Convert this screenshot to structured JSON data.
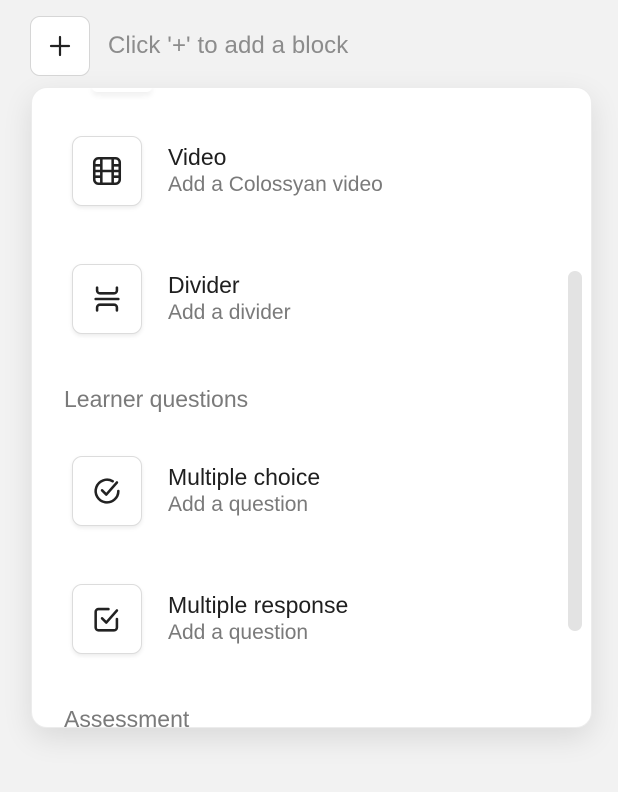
{
  "header": {
    "hint": "Click '+' to add a block"
  },
  "menu": {
    "items": [
      {
        "title": "Video",
        "subtitle": "Add a Colossyan video",
        "icon": "film-icon"
      },
      {
        "title": "Divider",
        "subtitle": "Add a divider",
        "icon": "divider-icon"
      },
      {
        "title": "Multiple choice",
        "subtitle": "Add a question",
        "icon": "circle-check-icon"
      },
      {
        "title": "Multiple response",
        "subtitle": "Add a question",
        "icon": "square-check-icon"
      }
    ],
    "sections": {
      "learner_questions": "Learner questions",
      "assessment": "Assessment"
    }
  },
  "colors": {
    "background": "#f2f2f2",
    "panel": "#ffffff",
    "title_text": "#1f1f1f",
    "muted_text": "#7a7a7a",
    "icon_stroke": "#222222"
  }
}
